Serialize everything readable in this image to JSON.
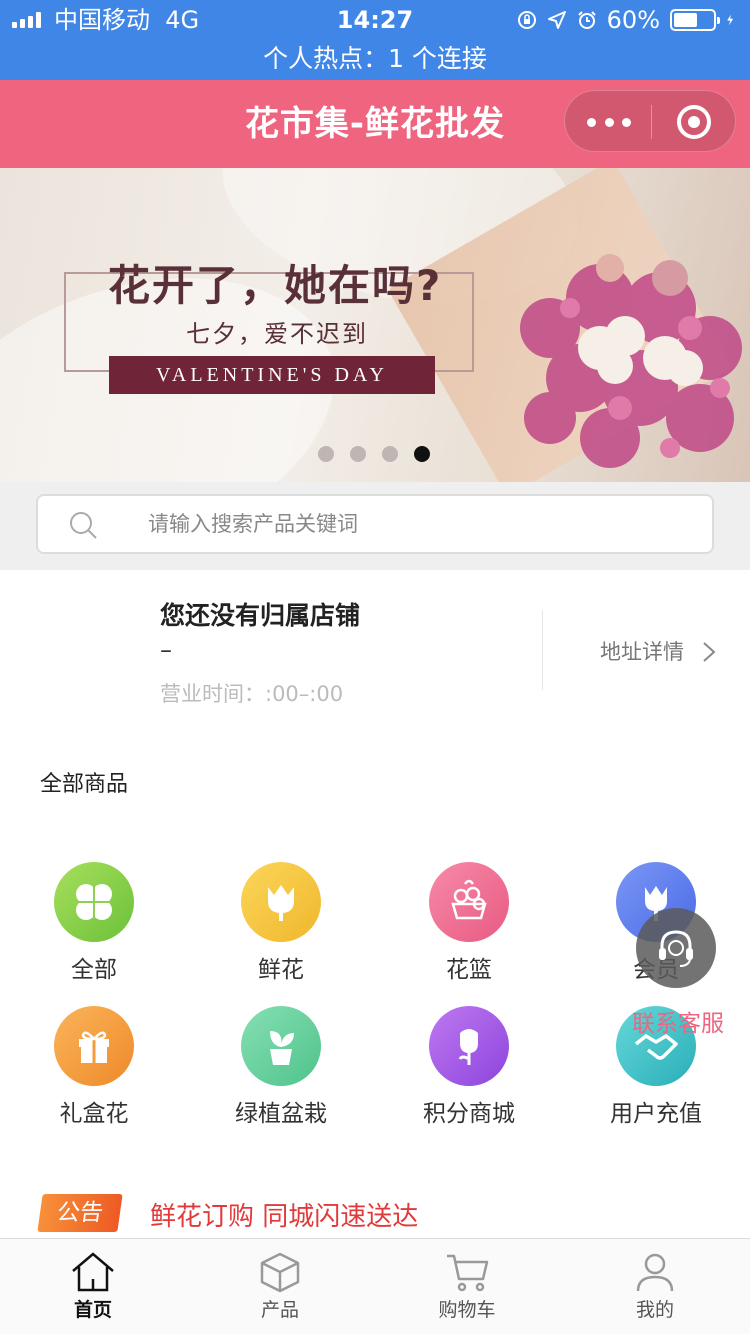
{
  "status_bar": {
    "carrier": "中国移动",
    "network": "4G",
    "time": "14:27",
    "battery": "60%",
    "hotspot": "个人热点：1 个连接"
  },
  "header": {
    "title": "花市集-鲜花批发",
    "bg_color": "#ef6580"
  },
  "banner": {
    "headline": "花开了，她在吗?",
    "subline": "七夕，爱不迟到",
    "tag": "VALENTINE'S DAY",
    "slide_count": 4,
    "active_slide": 4
  },
  "search": {
    "placeholder": "请输入搜索产品关键词"
  },
  "store": {
    "name": "您还没有归属店铺",
    "address_line": "–",
    "hours": "营业时间：:00–:00",
    "address_link": "地址详情"
  },
  "section": {
    "all_products": "全部商品"
  },
  "categories": [
    {
      "label": "全部",
      "icon": "clover-icon",
      "color": "#8fd14f"
    },
    {
      "label": "鲜花",
      "icon": "tulip-icon",
      "color": "#f5c744"
    },
    {
      "label": "花篮",
      "icon": "flower-basket-icon",
      "color": "#f26e93"
    },
    {
      "label": "会员",
      "icon": "tulip-icon",
      "color": "#5b7df0"
    },
    {
      "label": "礼盒花",
      "icon": "gift-box-icon",
      "color": "#f59b3d"
    },
    {
      "label": "绿植盆栽",
      "icon": "potted-plant-icon",
      "color": "#6dd3a0"
    },
    {
      "label": "积分商城",
      "icon": "rose-icon",
      "color": "#a85ce8"
    },
    {
      "label": "用户充值",
      "icon": "handshake-icon",
      "color": "#3fc4c8"
    }
  ],
  "contact": {
    "label": "联系客服",
    "icon": "headset-icon"
  },
  "notice": {
    "tag": "公告",
    "text": "鲜花订购 同城闪速送达"
  },
  "tabbar": [
    {
      "label": "首页",
      "icon": "home-icon",
      "active": true
    },
    {
      "label": "产品",
      "icon": "box-icon",
      "active": false
    },
    {
      "label": "购物车",
      "icon": "cart-icon",
      "active": false
    },
    {
      "label": "我的",
      "icon": "user-icon",
      "active": false
    }
  ]
}
